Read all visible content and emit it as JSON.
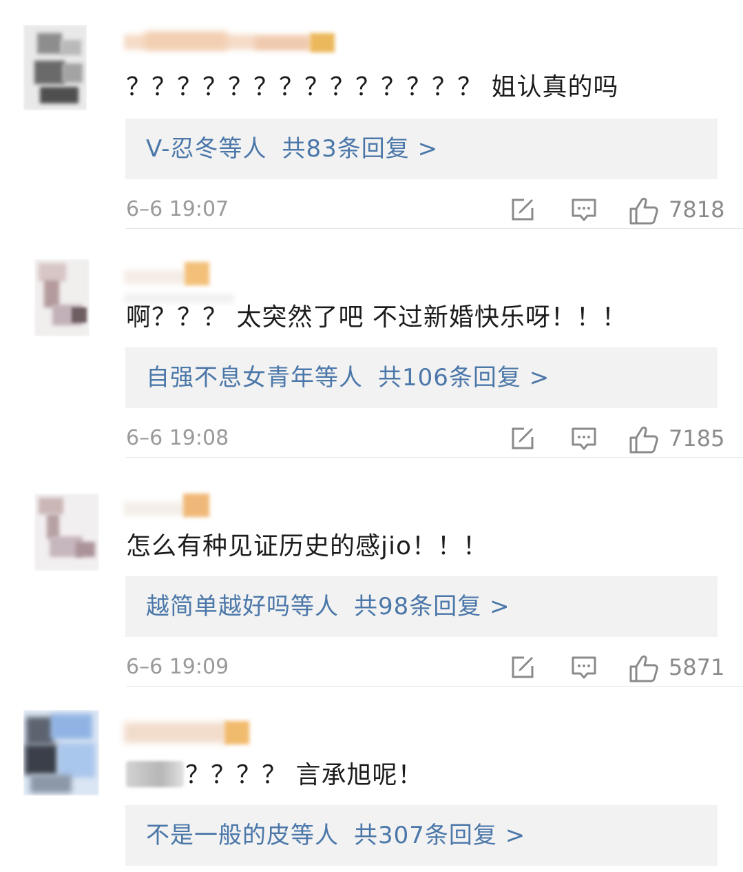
{
  "comments": [
    {
      "text": "？？？？？？？？？？？？？？ 姐认真的吗",
      "reply_who": "V-忍冬等人",
      "reply_count": "共83条回复 >",
      "time": "6–6 19:07",
      "likes": "7818"
    },
    {
      "text": "啊？？？ 太突然了吧 不过新婚快乐呀！！！",
      "reply_who": "自强不息女青年等人",
      "reply_count": "共106条回复 >",
      "time": "6–6 19:08",
      "likes": "7185"
    },
    {
      "text": "怎么有种见证历史的感jio！！！",
      "reply_who": "越简单越好吗等人",
      "reply_count": "共98条回复 >",
      "time": "6–6 19:09",
      "likes": "5871"
    },
    {
      "text": "？？？？ 言承旭呢！",
      "reply_who": "不是一般的皮等人",
      "reply_count": "共307条回复 >",
      "time": "",
      "likes": ""
    }
  ],
  "icons": {
    "edit": "edit-icon",
    "reply": "comment-icon",
    "like": "thumbs-up-icon"
  },
  "colors": {
    "link": "#4b77a9",
    "text": "#1c1c1c",
    "meta": "#9a9a9a",
    "reply_bg": "#f2f2f2"
  }
}
